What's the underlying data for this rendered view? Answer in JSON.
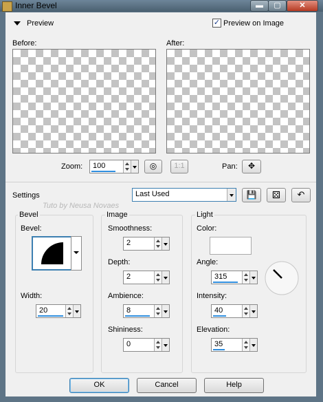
{
  "window": {
    "title": "Inner Bevel",
    "min_glyph": "▬",
    "max_glyph": "▢",
    "close_glyph": "✕"
  },
  "preview": {
    "section_label": "Preview",
    "preview_on_image_label": "Preview on Image",
    "preview_on_image_checked": true,
    "checkmark": "✓",
    "before_label": "Before:",
    "after_label": "After:",
    "zoom_label": "Zoom:",
    "zoom_value": "100",
    "zoom_fraction": 0.8,
    "one_to_one_label": "1:1",
    "pan_label": "Pan:",
    "pan_glyph": "✥",
    "fit_glyph": "◎"
  },
  "settings": {
    "label": "Settings",
    "preset_value": "Last Used",
    "save_glyph": "💾",
    "randomize_glyph": "⚄",
    "reset_glyph": "↶",
    "watermark": "Tuto by Neusa Novaes"
  },
  "bevel": {
    "group_label": "Bevel",
    "bevel_label": "Bevel:",
    "width_label": "Width:",
    "width_value": "20",
    "width_fraction": 0.85
  },
  "image": {
    "group_label": "Image",
    "smoothness_label": "Smoothness:",
    "smoothness_value": "2",
    "depth_label": "Depth:",
    "depth_value": "2",
    "ambience_label": "Ambience:",
    "ambience_value": "8",
    "ambience_fraction": 0.85,
    "shininess_label": "Shininess:",
    "shininess_value": "0"
  },
  "light": {
    "group_label": "Light",
    "color_label": "Color:",
    "color_value": "#ffffff",
    "angle_label": "Angle:",
    "angle_value": "315",
    "angle_fraction": 0.85,
    "intensity_label": "Intensity:",
    "intensity_value": "40",
    "intensity_fraction": 0.45,
    "elevation_label": "Elevation:",
    "elevation_value": "35",
    "elevation_fraction": 0.4
  },
  "buttons": {
    "ok": "OK",
    "cancel": "Cancel",
    "help": "Help"
  },
  "colors": {
    "accent": "#2f8ede",
    "title_bar": "#5e7486",
    "close": "#c8452c"
  }
}
